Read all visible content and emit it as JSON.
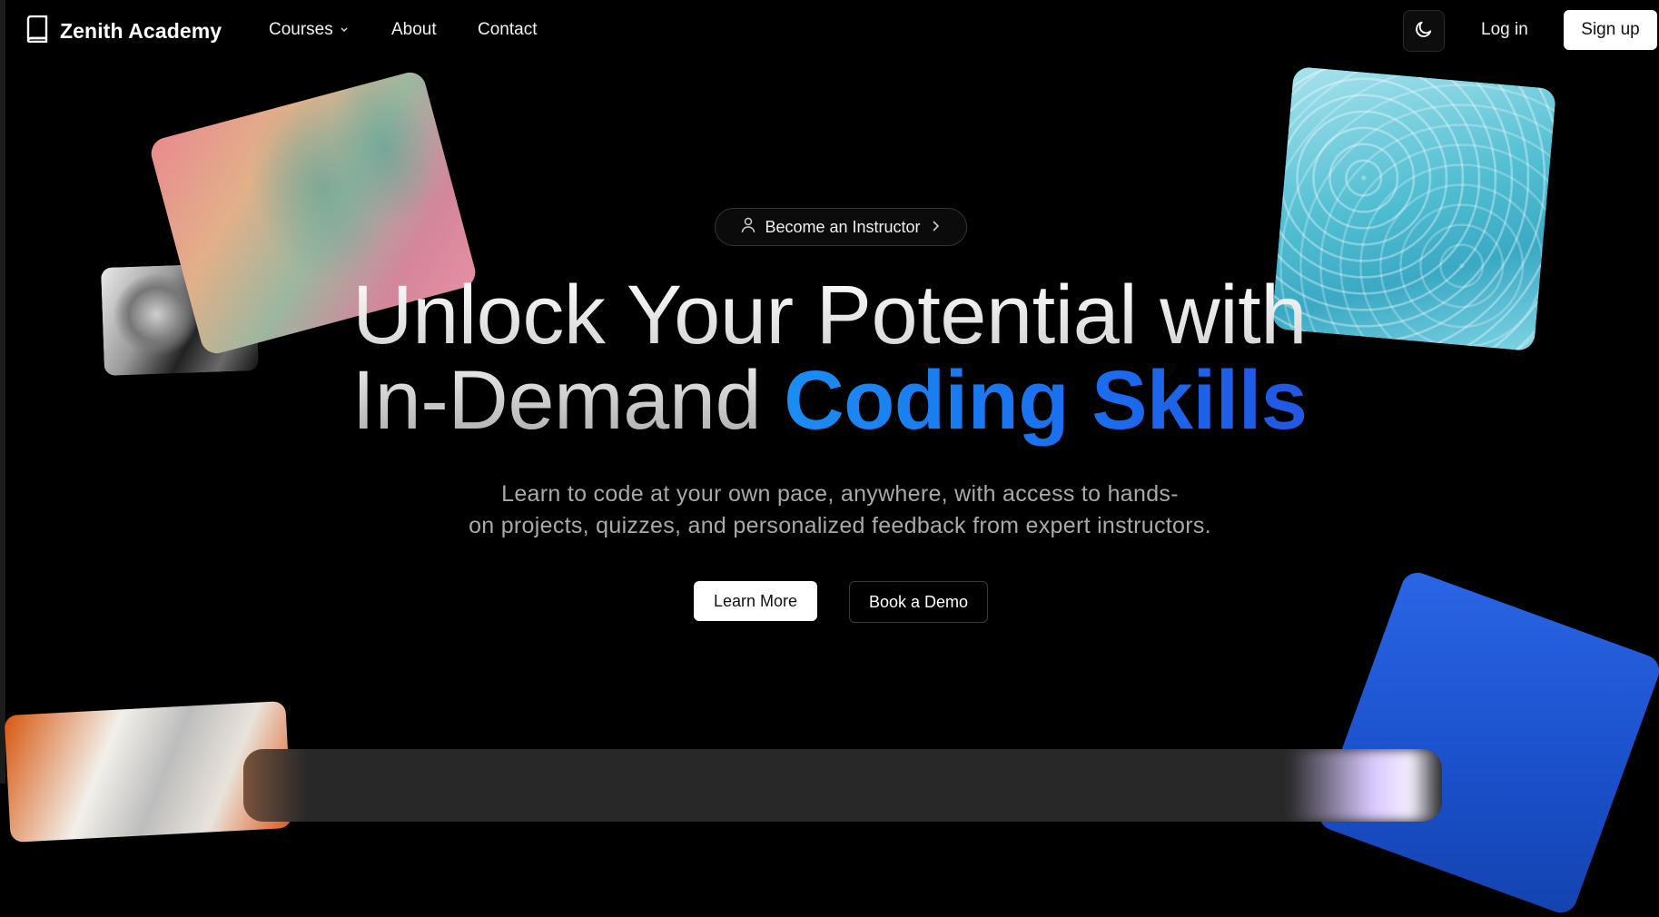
{
  "brand": {
    "name": "Zenith Academy",
    "icon": "book-icon"
  },
  "nav": {
    "links": [
      {
        "label": "Courses",
        "has_dropdown": true
      },
      {
        "label": "About"
      },
      {
        "label": "Contact"
      }
    ],
    "theme_toggle_icon": "moon-icon",
    "login_label": "Log in",
    "signup_label": "Sign up"
  },
  "hero": {
    "pill_label": "Become an Instructor",
    "headline_line1": "Unlock Your Potential with",
    "headline_line2_plain": "In-Demand ",
    "headline_line2_accent": "Coding Skills",
    "subtitle_line1": "Learn to code at your own pace, anywhere, with access to hands-",
    "subtitle_line2": "on projects, quizzes, and personalized feedback from expert instructors.",
    "primary_cta": "Learn More",
    "secondary_cta": "Book a Demo"
  },
  "colors": {
    "background": "#000000",
    "accent_start": "#1b8df2",
    "accent_end": "#2257e3",
    "subtitle_text": "#a9a9a9"
  }
}
